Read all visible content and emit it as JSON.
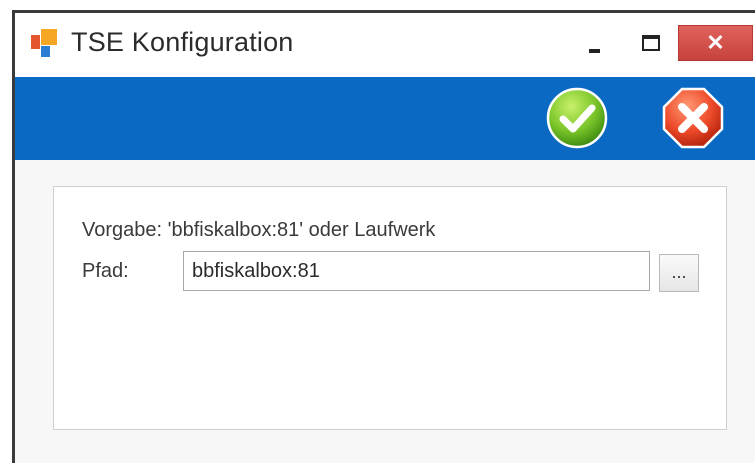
{
  "window": {
    "title": "TSE Konfiguration",
    "icon": "app-logo-icon",
    "controls": {
      "minimize": "minimize-icon",
      "maximize": "maximize-icon",
      "close_glyph": "✕"
    }
  },
  "toolbar": {
    "ok_icon": "check-icon",
    "cancel_icon": "x-icon",
    "accent_color": "#0a6ac3"
  },
  "form": {
    "hint": "Vorgabe: 'bbfiskalbox:81' oder Laufwerk",
    "path_label": "Pfad:",
    "path_value": "bbfiskalbox:81",
    "browse_label": "..."
  }
}
